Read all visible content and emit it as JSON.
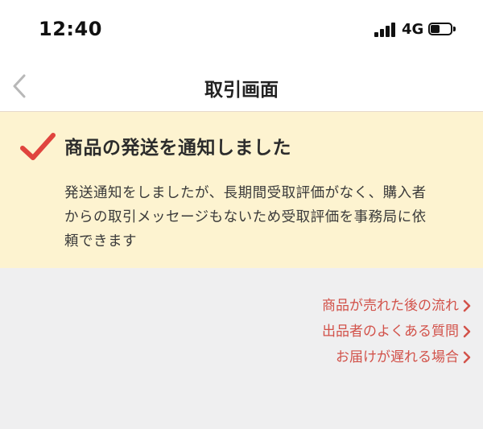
{
  "status_bar": {
    "time": "12:40",
    "network": "4G",
    "icons": [
      "signal-bars-icon",
      "battery-icon"
    ]
  },
  "nav": {
    "title": "取引画面",
    "back_icon": "chevron-left-icon"
  },
  "notice": {
    "icon": "checkmark-icon",
    "title": "商品の発送を通知しました",
    "body_lines": [
      "発送通知をしましたが、長期間受取評価がなく、購入者",
      "からの取引メッセージもないため受取評価を事務局に依",
      "頼できます"
    ]
  },
  "links": [
    {
      "label": "商品が売れた後の流れ"
    },
    {
      "label": "出品者のよくある質問"
    },
    {
      "label": "お届けが遅れる場合"
    }
  ],
  "colors": {
    "accent": "#e0443e",
    "link": "#d2524a",
    "notice_bg": "#fdf3d0",
    "page_bg": "#efeff0"
  }
}
